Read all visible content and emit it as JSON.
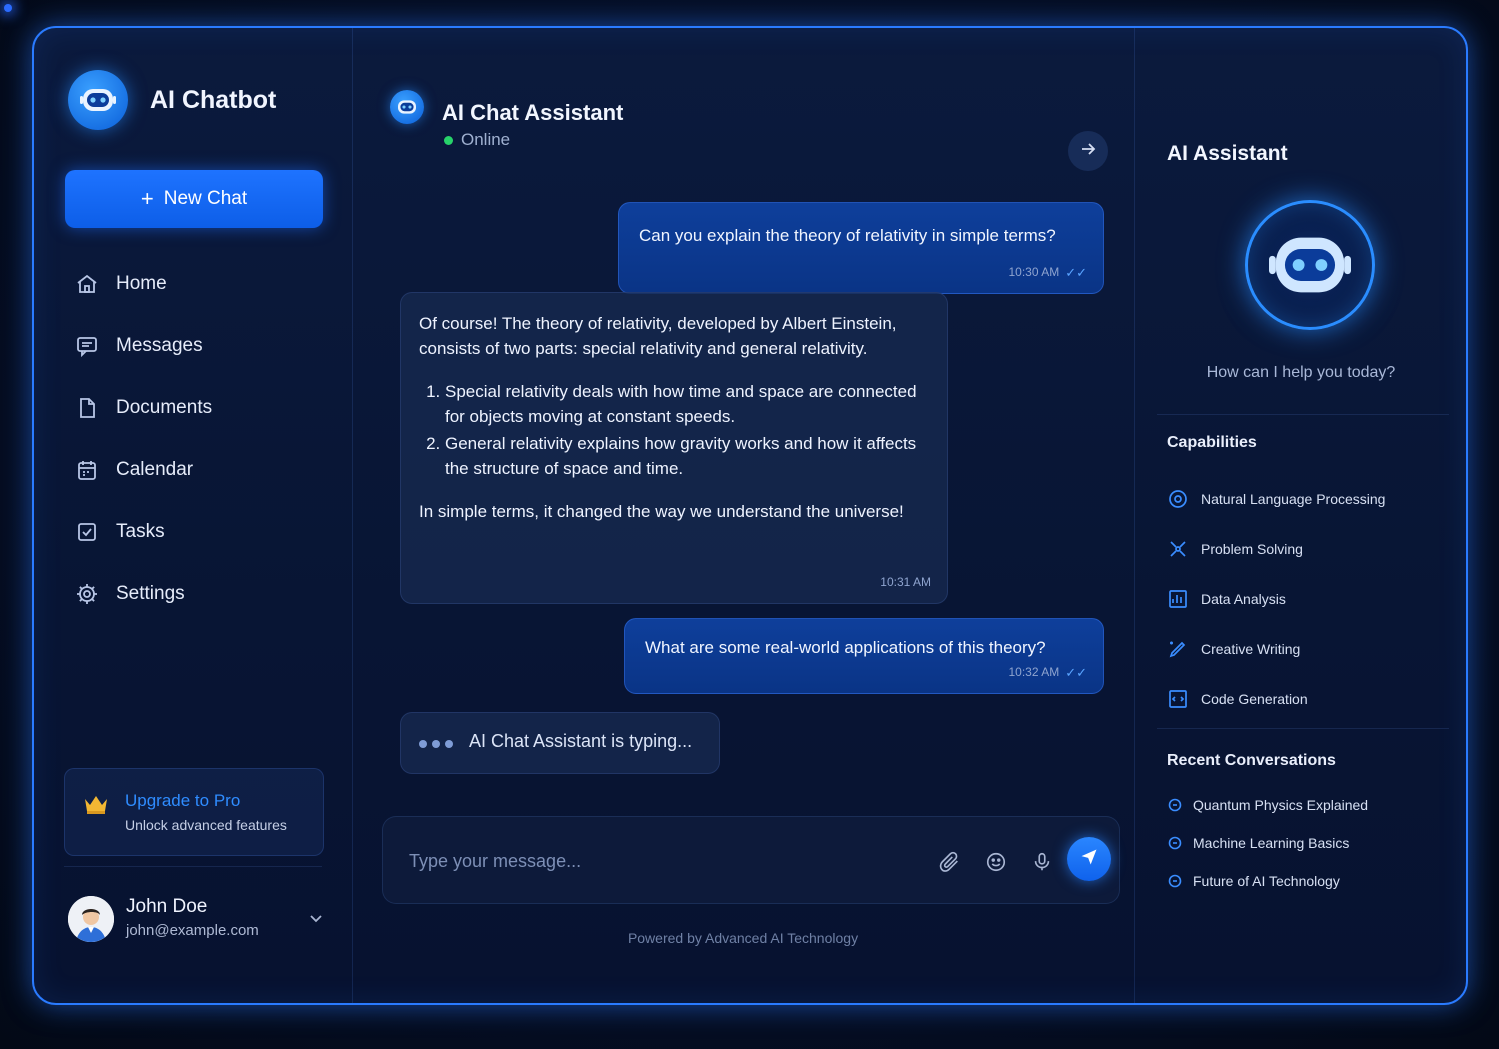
{
  "brand": {
    "title": "AI Chatbot"
  },
  "sidebar": {
    "new_chat_label": "New Chat",
    "items": [
      {
        "label": "Home",
        "icon": "home-icon"
      },
      {
        "label": "Messages",
        "icon": "message-icon"
      },
      {
        "label": "Documents",
        "icon": "document-icon"
      },
      {
        "label": "Calendar",
        "icon": "calendar-icon"
      },
      {
        "label": "Tasks",
        "icon": "tasks-icon"
      },
      {
        "label": "Settings",
        "icon": "gear-icon"
      }
    ],
    "upgrade": {
      "title": "Upgrade to Pro",
      "subtitle": "Unlock advanced features"
    },
    "user": {
      "name": "John Doe",
      "email": "john@example.com"
    }
  },
  "chat": {
    "title": "AI Chat Assistant",
    "status": "Online",
    "messages": [
      {
        "role": "user",
        "text": "Can you explain the theory of relativity in simple terms?",
        "time": "10:30 AM"
      },
      {
        "role": "assistant",
        "intro": "Of course! The theory of relativity, developed by Albert Einstein, consists of two parts: special relativity and general relativity.",
        "points": [
          "Special relativity deals with how time and space are connected for objects moving at constant speeds.",
          "General relativity explains how gravity works and how it affects the structure of space and time."
        ],
        "conclusion": "In simple terms, it changed the way we understand the universe!",
        "time": "10:31 AM"
      },
      {
        "role": "user",
        "text": "What are some real-world applications of this theory?",
        "time": "10:32 AM"
      }
    ],
    "typing_text": "AI Chat Assistant is typing...",
    "input_placeholder": "Type your message...",
    "footer": "Powered by Advanced AI Technology"
  },
  "assistant_panel": {
    "title": "AI Assistant",
    "prompt": "How can I help you today?",
    "capabilities_title": "Capabilities",
    "capabilities": [
      "Natural Language Processing",
      "Problem Solving",
      "Data Analysis",
      "Creative Writing",
      "Code Generation"
    ],
    "recent_title": "Recent Conversations",
    "recent": [
      "Quantum Physics Explained",
      "Machine Learning Basics",
      "Future of AI Technology"
    ]
  },
  "colors": {
    "accent": "#1e73ff",
    "online": "#27d36a",
    "background": "#06102a"
  }
}
